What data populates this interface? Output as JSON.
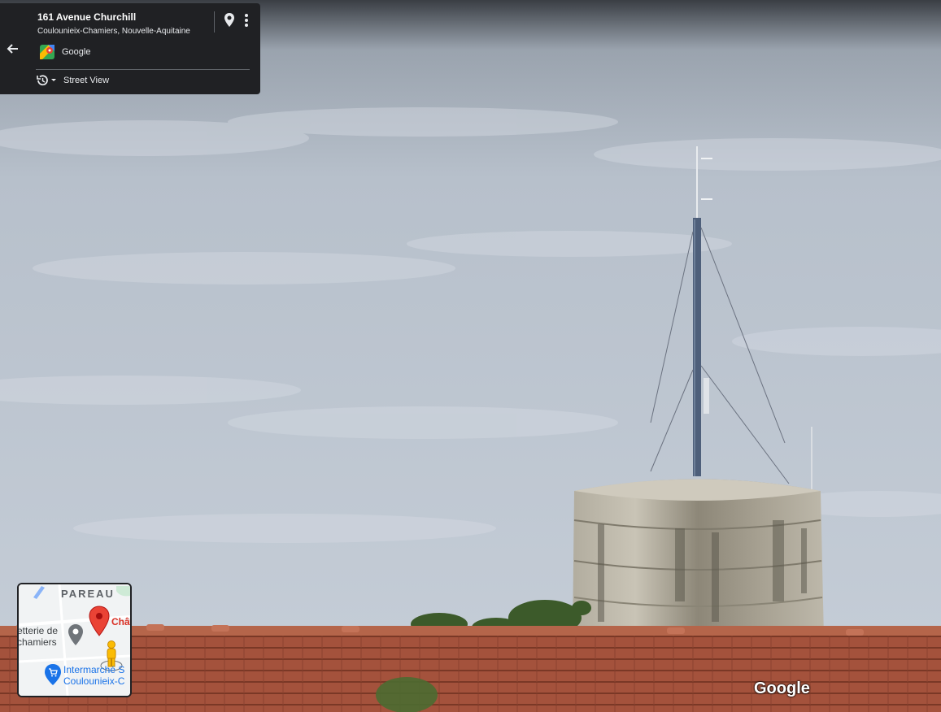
{
  "info_card": {
    "title": "161 Avenue Churchill",
    "subtitle": "Coulounieix-Chamiers, Nouvelle-Aquitaine",
    "provider": "Google",
    "mode": "Street View"
  },
  "minimap": {
    "area_label": "PAREAU",
    "place_1": "Chât",
    "place_2_line1": "etterie de",
    "place_2_line2": "chamiers",
    "place_3_line1": "Intermarché S",
    "place_3_line2": "Coulounieix-C"
  },
  "watermark": "Google",
  "colors": {
    "card_bg": "#202124",
    "sky": "#b9c3cf",
    "roof": "#a5523b",
    "pin_red": "#ea4335",
    "poi_blue": "#1a73e8"
  },
  "icons": {
    "back": "arrow-left-icon",
    "pin": "location-pin-icon",
    "more": "more-vert-icon",
    "history": "history-icon",
    "pegman": "pegman-icon"
  }
}
